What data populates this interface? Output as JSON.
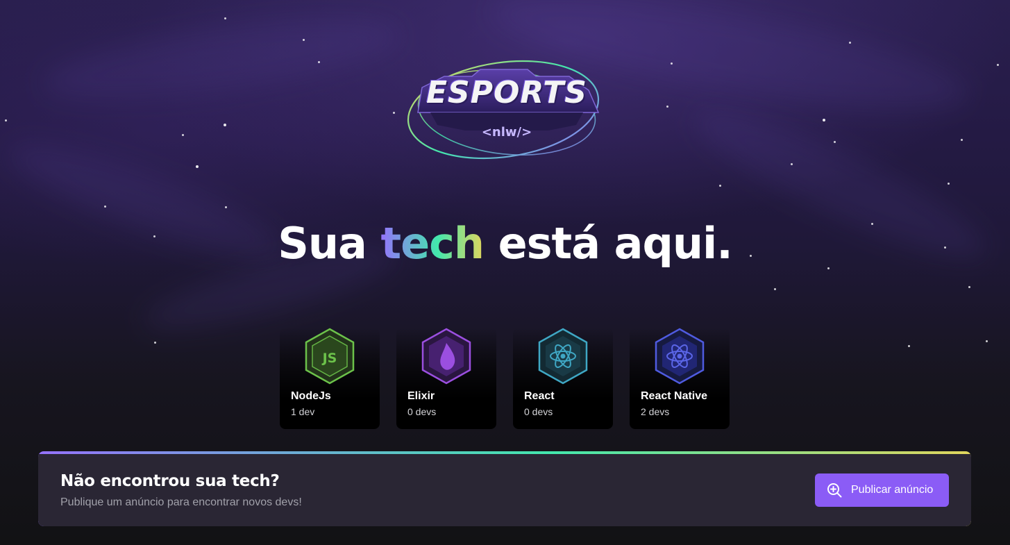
{
  "logo": {
    "wordmark": "ESPORTS",
    "tag": "<nlw/>"
  },
  "headline": {
    "before": "Sua ",
    "highlight": "tech",
    "after": " está aqui."
  },
  "techs": [
    {
      "name": "NodeJs",
      "count": "1 dev",
      "icon": "nodejs-icon",
      "color": "#6CC24A"
    },
    {
      "name": "Elixir",
      "count": "0 devs",
      "icon": "elixir-icon",
      "color": "#8B3FC9"
    },
    {
      "name": "React",
      "count": "0 devs",
      "icon": "react-icon",
      "color": "#3FA7C4"
    },
    {
      "name": "React Native",
      "count": "2 devs",
      "icon": "react-native-icon",
      "color": "#4F5BE0"
    }
  ],
  "banner": {
    "title": "Não encontrou sua tech?",
    "subtitle": "Publique um anúncio para encontrar novos devs!",
    "button_label": "Publicar anúncio",
    "button_icon": "magnifying-glass-plus-icon"
  },
  "colors": {
    "accent": "#8B5CF6",
    "gradient_start": "#9572FC",
    "gradient_mid": "#43E7AD",
    "gradient_end": "#E1D55D",
    "banner_bg": "#2A2634"
  }
}
